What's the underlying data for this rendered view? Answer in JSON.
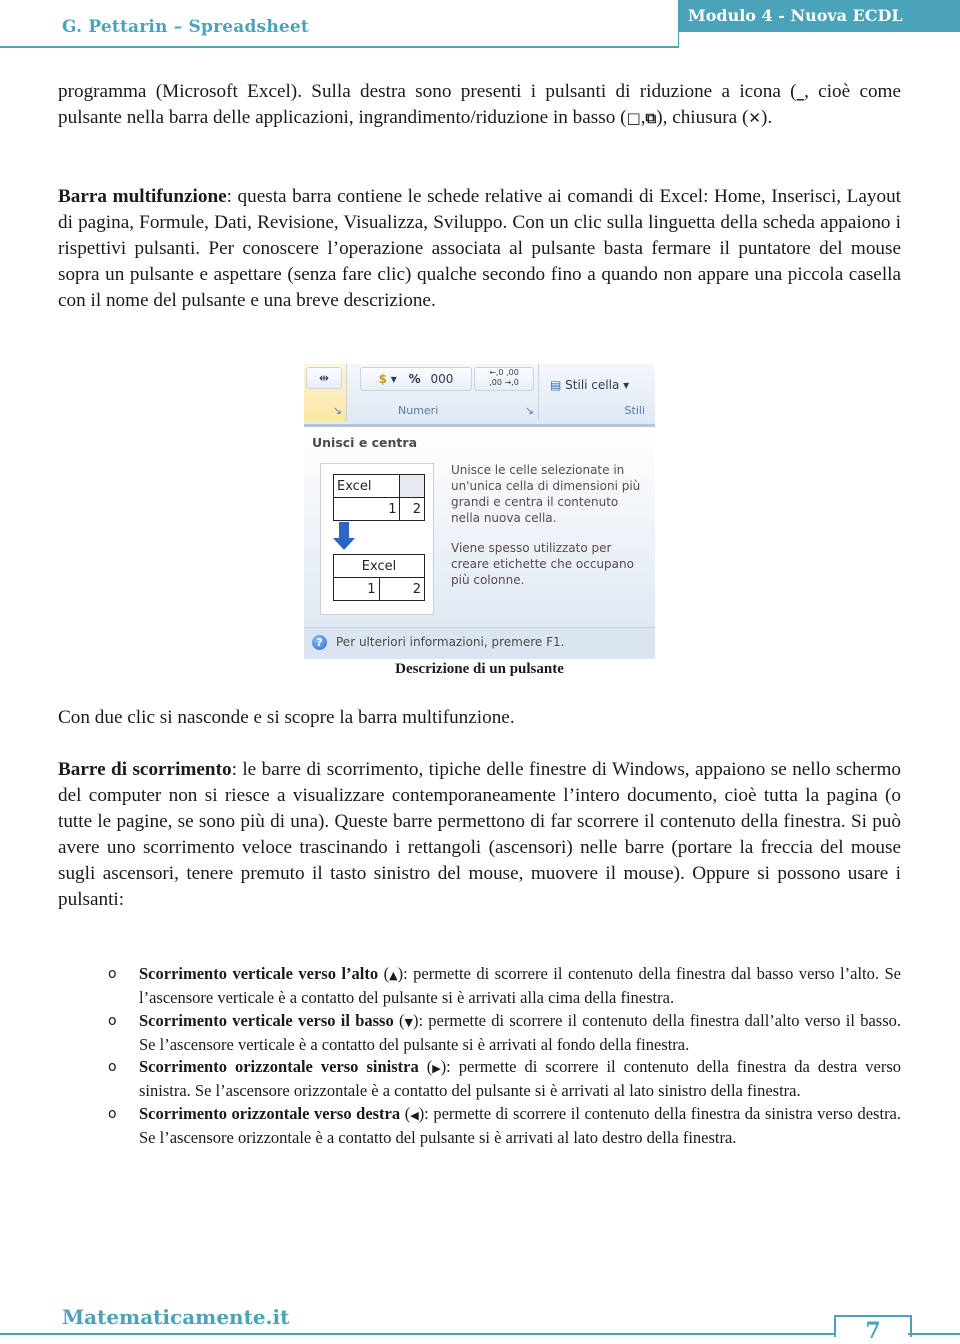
{
  "header": {
    "left_title": "G. Pettarin – Spreadsheet",
    "right_title": "Modulo 4 - Nuova ECDL",
    "accent_color": "#4aa3b8"
  },
  "intro": {
    "text_1": "programma (Microsoft Excel). Sulla destra sono presenti i pulsanti di riduzione a icona (",
    "icon_minimize": "_",
    "text_2": ", cioè come pulsante nella barra delle applicazioni, ingrandimento/riduzione in basso (",
    "icon_maximize": "□",
    "sep": ",",
    "icon_restore": "⧉",
    "text_3": "), chiusura (",
    "icon_close": "✕",
    "text_4": ")."
  },
  "ribbon_section": {
    "term": "Barra multifunzione",
    "text": ": questa barra contiene le schede relative ai comandi di Excel: Home, Inserisci, Layout di pagina, Formule, Dati, Revisione, Visualizza, Sviluppo. Con un clic sulla linguetta della scheda appaiono i rispettivi pulsanti. Per conoscere l’operazione associata al pulsante basta fermare il puntatore del mouse sopra un pulsante e aspettare (senza fare clic) qualche secondo fino a quando non appare una piccola casella con il nome del pulsante e una breve descrizione."
  },
  "figure": {
    "ribbon": {
      "groups": [
        {
          "label": ""
        },
        {
          "label": "Numeri"
        },
        {
          "label": "Stili"
        }
      ],
      "buttons": {
        "merge": "⇹",
        "currency": "$",
        "percent": "%",
        "thousands": "000",
        "inc_decimal": "←,0 ,00",
        "dec_decimal": ",00 →,0",
        "cell_styles": "Stili cella ▾"
      }
    },
    "tooltip": {
      "title": "Unisci e centra",
      "table_before": {
        "header": "Excel",
        "row": [
          "1",
          "2"
        ]
      },
      "table_after": {
        "header": "Excel",
        "row": [
          "1",
          "2"
        ]
      },
      "desc_1": "Unisce le celle selezionate in un'unica cella di dimensioni più grandi e centra il contenuto nella nuova cella.",
      "desc_2": "Viene spesso utilizzato per creare etichette che occupano più colonne.",
      "footer": "Per ulteriori informazioni, premere F1."
    },
    "caption": "Descrizione di un pulsante"
  },
  "double_click_note": "Con due clic si nasconde e si scopre la barra multifunzione.",
  "scroll_section": {
    "term": "Barre di scorrimento",
    "text": ": le barre di scorrimento, tipiche delle finestre di Windows, appaiono se nello schermo del computer non si riesce a visualizzare contemporaneamente l’intero documento, cioè tutta la pagina (o tutte le pagine, se sono più di una). Queste barre permettono di far scorrere il contenuto della finestra. Si può avere uno scorrimento veloce trascinando i rettangoli (ascensori) nelle barre (portare la freccia del mouse sugli ascensori, tenere premuto il tasto sinistro del mouse, muovere il mouse). Oppure si possono usare i pulsanti:"
  },
  "scroll_buttons": [
    {
      "bullet": "o",
      "term": "Scorrimento verticale verso l’alto",
      "icon": "▲",
      "text": "): permette di scorrere il contenuto della finestra dal basso verso l’alto. Se l’ascensore verticale è a contatto del pulsante si è arrivati alla cima della finestra."
    },
    {
      "bullet": "o",
      "term": "Scorrimento verticale verso il basso",
      "icon": "▼",
      "text": "): permette di scorrere il contenuto della finestra dall’alto verso il basso. Se l’ascensore verticale è a contatto del pulsante si è arrivati al fondo della finestra."
    },
    {
      "bullet": "o",
      "term": "Scorrimento orizzontale verso sinistra",
      "icon": "▶",
      "text": "): permette di scorrere il contenuto della finestra da destra verso sinistra. Se l’ascensore orizzontale è a contatto del pulsante si è arrivati al lato sinistro della finestra."
    },
    {
      "bullet": "o",
      "term": "Scorrimento orizzontale verso destra",
      "icon": "◀",
      "text": "): permette di scorrere il contenuto della finestra da sinistra verso destra. Se l’ascensore orizzontale è a contatto del pulsante si è arrivati al lato destro della finestra."
    }
  ],
  "footer": {
    "site": "Matematicamente.it",
    "page_number": "7"
  }
}
